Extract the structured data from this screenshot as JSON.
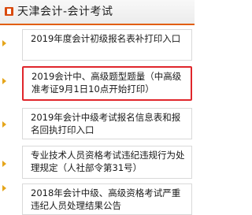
{
  "header": {
    "title": "天津会计-会计考试"
  },
  "items": [
    {
      "label": "2019年度会计初级报名表补打印入口"
    },
    {
      "label": "2019会计中、高级题型题量（中高级准考证9月1日10点开始打印）"
    },
    {
      "label": "2019年会计中级考试报名信息表和报名回执打印入口"
    },
    {
      "label": "专业技术人员资格考试违纪违规行为处理规定（人社部令第31号）"
    },
    {
      "label": "2018年会计中级、高级资格考试严重违纪人员处理结果公告"
    }
  ],
  "colors": {
    "accent": "#e25e05",
    "highlight_border": "#e0262b",
    "bullet": "#e5a51a"
  },
  "icons": {
    "header": "document-icon",
    "bullet": "triangle-right-icon"
  }
}
